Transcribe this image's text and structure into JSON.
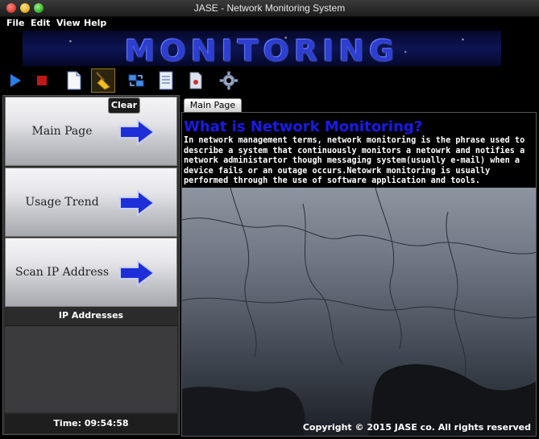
{
  "window": {
    "title": "JASE - Network Monitoring System"
  },
  "menu": {
    "items": [
      "File",
      "Edit",
      "View",
      "Help"
    ]
  },
  "banner": {
    "text": "MONITORING"
  },
  "toolbar": {
    "buttons": [
      {
        "name": "play-icon"
      },
      {
        "name": "stop-icon"
      },
      {
        "name": "new-document-icon"
      },
      {
        "name": "broom-icon",
        "active": true
      },
      {
        "name": "network-transfer-icon"
      },
      {
        "name": "report-icon"
      },
      {
        "name": "export-icon"
      },
      {
        "name": "gear-icon"
      }
    ],
    "tooltip": "Clear"
  },
  "sidebar": {
    "nav": [
      {
        "label": "Main Page"
      },
      {
        "label": "Usage Trend"
      },
      {
        "label": "Scan IP Address"
      }
    ],
    "ip_header": "IP Addresses",
    "time": "Time: 09:54:58"
  },
  "main": {
    "tab": "Main Page",
    "title": "What is Network Monitoring?",
    "body": "In network management terms, network monitoring is the phrase used to describe a system that continuously monitors a netowrk and notifies a network administartor though messaging system(usually e-mail) when a device fails or an outage occurs.Netowrk monitoring is usually performed through the use of software application and tools.",
    "copyright": "Copyright © 2015 JASE co.  All rights reserved"
  },
  "colors": {
    "title_blue": "#1a1ae8",
    "banner_blue": "#2d3fd0",
    "arrow_blue": "#1e2fd8"
  }
}
